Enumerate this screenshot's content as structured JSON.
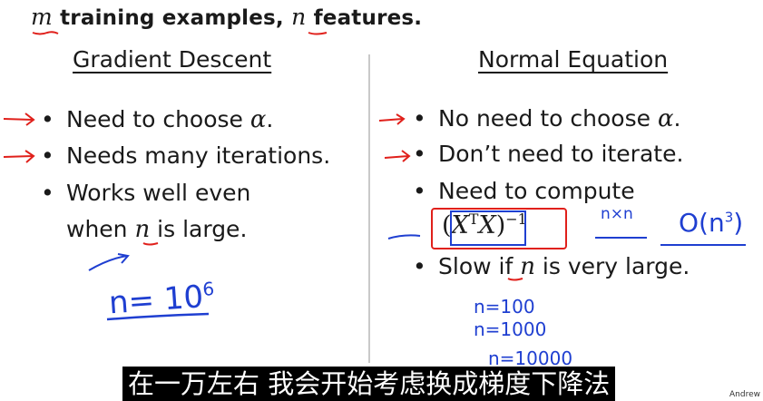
{
  "header": {
    "var_m": "m",
    "text_1": " training examples, ",
    "var_n": "n",
    "text_2": " features."
  },
  "left": {
    "title": "Gradient Descent",
    "bullets": [
      {
        "prefix": "Need to choose ",
        "math": "α",
        "suffix": "."
      },
      {
        "text": "Needs many iterations."
      },
      {
        "line1": "Works well even",
        "line2_prefix": "when ",
        "math": "n",
        "line2_suffix": " is large."
      }
    ]
  },
  "right": {
    "title": "Normal Equation",
    "bullets": [
      {
        "prefix": "No need to choose ",
        "math": "α",
        "suffix": "."
      },
      {
        "text": "Don’t need to iterate."
      },
      {
        "text": "Need to compute"
      },
      {
        "prefix": "Slow if ",
        "math": "n",
        "suffix": " is very large."
      }
    ],
    "formula": {
      "open": "(",
      "x1": "X",
      "sup": "T",
      "x2": "X",
      "close": ")",
      "exp": "−1"
    }
  },
  "handwriting": {
    "n_eq_10_6": "n= 10",
    "n_eq_10_6_exp": "6",
    "nxn": "n×n",
    "big_o": "O(n",
    "big_o_exp": "3",
    "big_o_close": ")",
    "n100": "n=100",
    "n1000": "n=1000",
    "n10000": "n=10000"
  },
  "subtitle": "在一万左右 我会开始考虑换成梯度下降法",
  "credit": "Andrew",
  "colors": {
    "red_ink": "#e0201b",
    "blue_ink": "#1f3fd1",
    "subtitle_bg": "#000000"
  }
}
